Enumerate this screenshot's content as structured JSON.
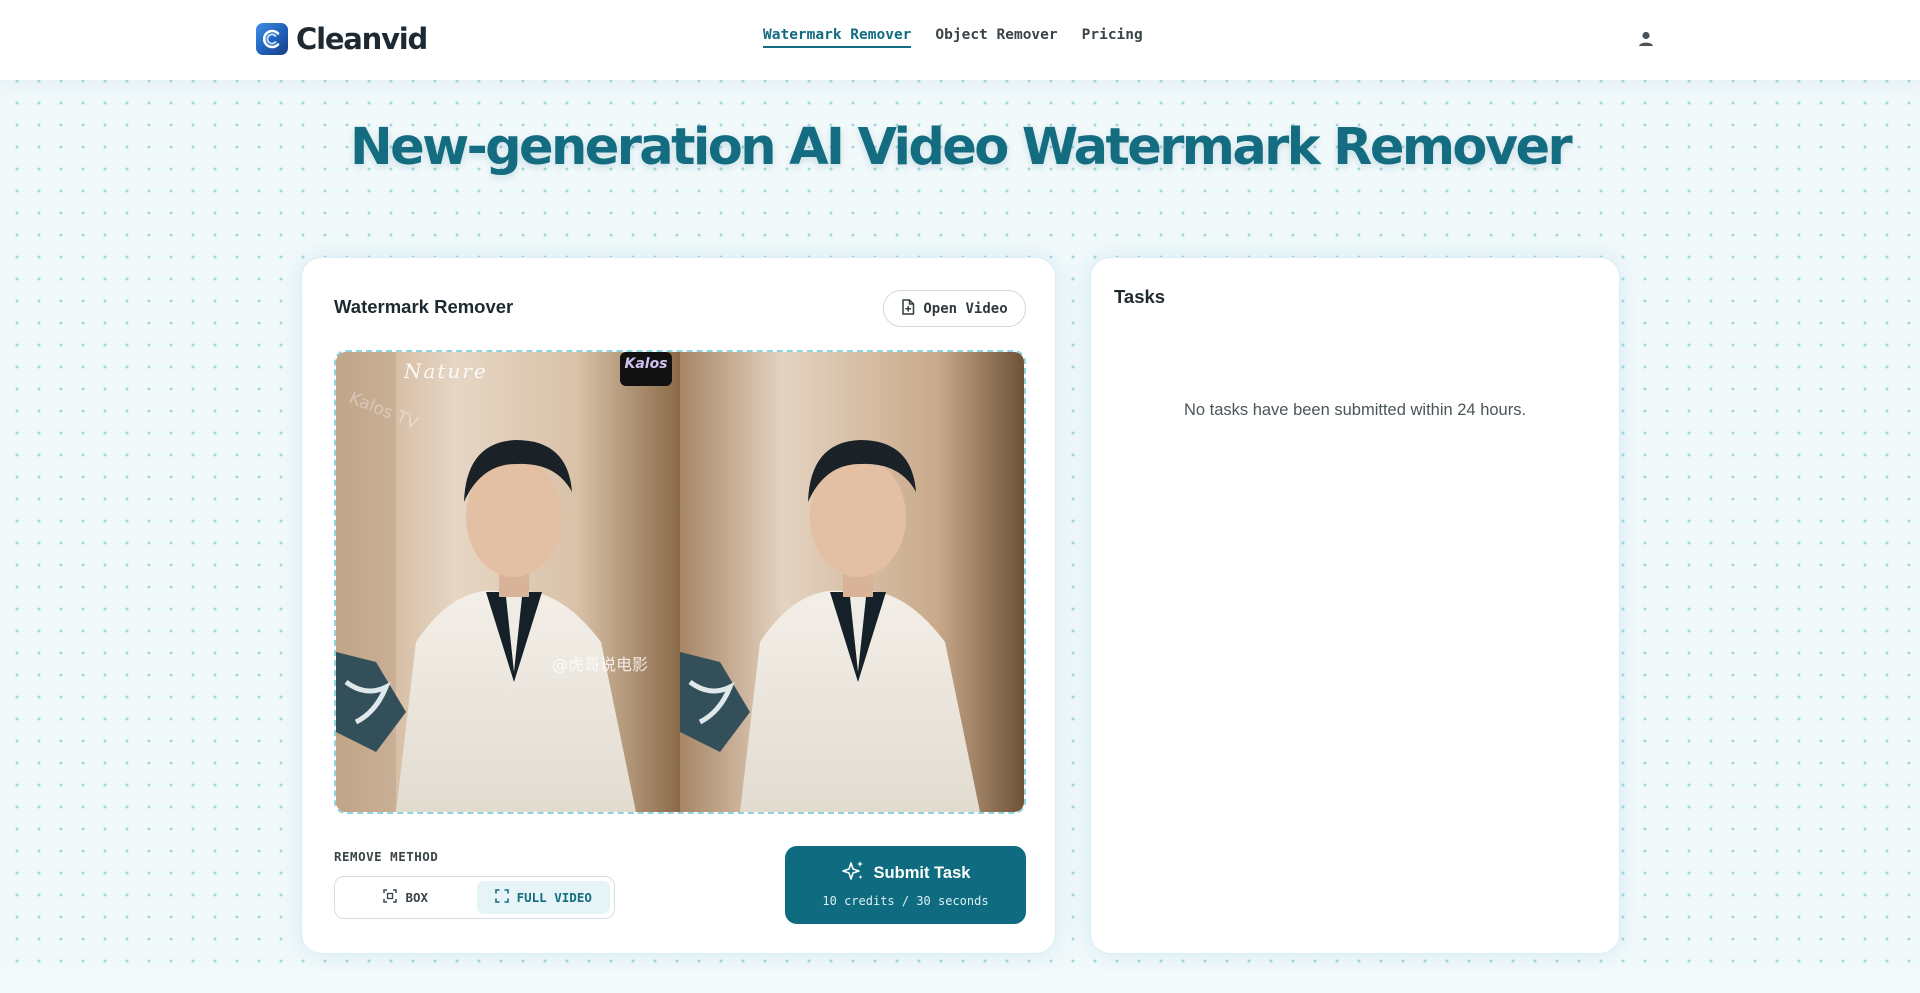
{
  "app": {
    "name": "Cleanvid"
  },
  "nav": {
    "items": [
      {
        "label": "Watermark Remover",
        "active": true
      },
      {
        "label": "Object Remover",
        "active": false
      },
      {
        "label": "Pricing",
        "active": false
      }
    ],
    "user_icon": "user-icon"
  },
  "hero": {
    "title": "New-generation AI Video Watermark Remover"
  },
  "remover": {
    "title": "Watermark Remover",
    "open_video_label": "Open Video",
    "open_video_icon": "file-plus-icon",
    "preview": {
      "watermark_texts": [
        "Nature",
        "Kalos",
        "Kalos TV",
        "@虎哥说电影"
      ]
    },
    "method_label": "REMOVE METHOD",
    "methods": [
      {
        "label": "BOX",
        "icon": "box-select-icon",
        "selected": false
      },
      {
        "label": "FULL VIDEO",
        "icon": "fullscreen-icon",
        "selected": true
      }
    ],
    "submit": {
      "label": "Submit Task",
      "icon": "sparkles-icon",
      "cost": "10 credits / 30 seconds"
    }
  },
  "tasks": {
    "title": "Tasks",
    "empty_message": "No tasks have been submitted within 24 hours."
  },
  "colors": {
    "accent": "#146c80",
    "submit_bg": "#0f6b80",
    "page_bg": "#f2f9fb",
    "dot": "#9fd6dd"
  }
}
